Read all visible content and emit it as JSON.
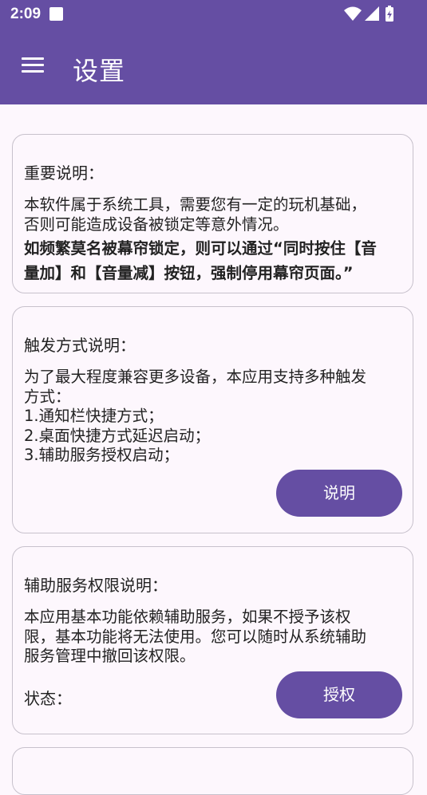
{
  "status_bar": {
    "time": "2:09",
    "icons": [
      "notification-square-icon",
      "wifi-icon",
      "signal-icon",
      "battery-charging-icon"
    ]
  },
  "app_bar": {
    "title": "设置",
    "menu_icon": "menu-icon"
  },
  "cards": [
    {
      "title": "重要说明：",
      "body_lines": [
        "本软件属于系统工具，需要您有一定的玩机基础，",
        "否则可能造成设备被锁定等意外情况。"
      ],
      "bold_lines": [
        "如频繁莫名被幕帘锁定，则可以通过“同时按住【音",
        "量加】和【音量减】按钮，强制停用幕帘页面。”"
      ]
    },
    {
      "title": "触发方式说明：",
      "body_lines": [
        "为了最大程度兼容更多设备，本应用支持多种触发",
        "方式：",
        "1.通知栏快捷方式；",
        "2.桌面快捷方式延迟启动；",
        "3.辅助服务授权启动；"
      ],
      "button": "说明"
    },
    {
      "title": "辅助服务权限说明：",
      "body_lines": [
        "本应用基本功能依赖辅助服务，如果不授予该权",
        "限，基本功能将无法使用。您可以随时从系统辅助",
        "服务管理中撤回该权限。"
      ],
      "status_label": "状态：",
      "button": "授权"
    }
  ],
  "colors": {
    "primary": "#654ea3",
    "background": "#fdf7fd",
    "card_border": "#c7c1cc",
    "text": "#222222"
  }
}
